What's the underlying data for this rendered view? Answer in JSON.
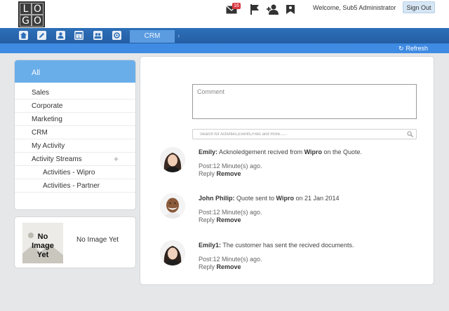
{
  "header": {
    "logo_letters": [
      "L",
      "O",
      "G",
      "O"
    ],
    "mail_badge": "16",
    "welcome_text": "Welcome, Sub5 Administrator",
    "signout_label": "Sign Out"
  },
  "nav": {
    "calendar_day": "1",
    "active_tab": "CRM",
    "separator": "›"
  },
  "subbar": {
    "refresh_label": "Refresh"
  },
  "sidebar": {
    "all_label": "All",
    "items": [
      {
        "label": "Sales"
      },
      {
        "label": "Corporate"
      },
      {
        "label": "Marketing"
      },
      {
        "label": "CRM"
      },
      {
        "label": "My Activity"
      },
      {
        "label": "Activity Streams"
      },
      {
        "label": "Activities - Wipro"
      },
      {
        "label": "Activities - Partner"
      }
    ],
    "add_symbol": "+"
  },
  "image_card": {
    "thumb_lines": [
      "No",
      "Image",
      "Yet"
    ],
    "caption": "No Image Yet"
  },
  "composer": {
    "comment_placeholder": "Comment",
    "search_placeholder": "Search for Activities,Events,Files and more......"
  },
  "posts": [
    {
      "author": "Emily:",
      "text_before": " Acknoledgement recived from ",
      "highlight": "Wipro",
      "text_after": " on the Quote.",
      "meta": "Post:12 Minute(s) ago.",
      "reply_label": "Reply",
      "remove_label": "Remove"
    },
    {
      "author": "John Philip:",
      "text_before": " Quote sent to ",
      "highlight": "Wipro",
      "text_after": " on 21 Jan 2014",
      "meta": "Post:12 Minute(s) ago.",
      "reply_label": "Reply",
      "remove_label": "Remove"
    },
    {
      "author": "Emily1:",
      "text_before": " The customer has sent the recived documents.",
      "highlight": "",
      "text_after": "",
      "meta": "Post:12 Minute(s) ago.",
      "reply_label": "Reply",
      "remove_label": "Remove"
    }
  ],
  "colors": {
    "nav_blue": "#2d6fb8",
    "subbar_blue": "#3f8be3",
    "active_tab": "#5b9be0",
    "sidebar_selected": "#6aaee9",
    "badge_red": "#d9363e"
  }
}
